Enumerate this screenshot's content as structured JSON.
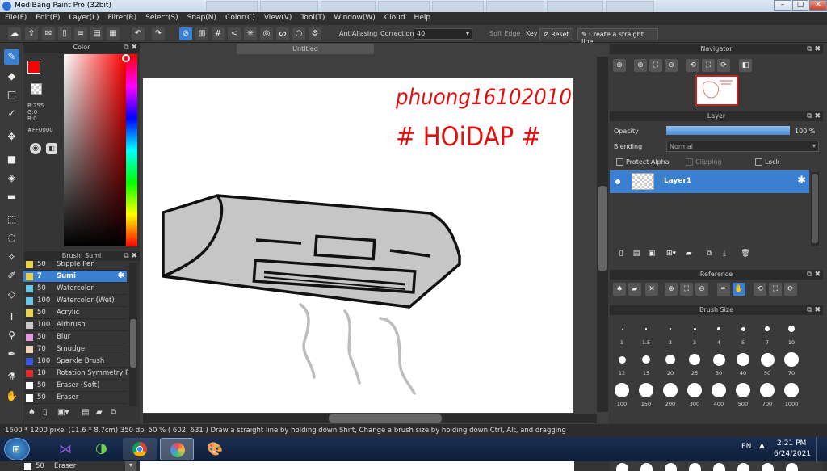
{
  "window": {
    "title": "MediBang Paint Pro (32bit)",
    "controls": [
      "–",
      "□",
      "✕"
    ]
  },
  "menu": [
    "File(F)",
    "Edit(E)",
    "Layer(L)",
    "Filter(R)",
    "Select(S)",
    "Snap(N)",
    "Color(C)",
    "View(V)",
    "Tool(T)",
    "Window(W)",
    "Cloud",
    "Help"
  ],
  "toolbar": {
    "antialiasing_label": "AntiAliasing",
    "correction_label": "Correction",
    "correction_value": "40",
    "soft_edge_label": "Soft Edge",
    "key_label": "Key",
    "reset_label": "Reset",
    "straight_line_label": "Create a straight line"
  },
  "color_panel": {
    "title": "Color",
    "rgb": [
      "R:255",
      "G:0",
      "B:0"
    ],
    "hex": "#FF0000",
    "primary_color": "#ff0000"
  },
  "brush_panel": {
    "title": "Brush: Sumi",
    "items": [
      {
        "size": "50",
        "name": "Stipple Pen",
        "color": "#e8d24a"
      },
      {
        "size": "7",
        "name": "Sumi",
        "color": "#e8d24a",
        "selected": true
      },
      {
        "size": "50",
        "name": "Watercolor",
        "color": "#67c7e8"
      },
      {
        "size": "100",
        "name": "Watercolor (Wet)",
        "color": "#67c7e8"
      },
      {
        "size": "50",
        "name": "Acrylic",
        "color": "#e8d24a"
      },
      {
        "size": "100",
        "name": "Airbrush",
        "color": "#c8c8c8"
      },
      {
        "size": "50",
        "name": "Blur",
        "color": "#e597e0"
      },
      {
        "size": "70",
        "name": "Smudge",
        "color": "#f2d2b8"
      },
      {
        "size": "100",
        "name": "Sparkle Brush",
        "color": "#3a55e0"
      },
      {
        "size": "10",
        "name": "Rotation Symmetry P",
        "color": "#e02a2a"
      },
      {
        "size": "50",
        "name": "Eraser (Soft)",
        "color": "#ffffff"
      },
      {
        "size": "50",
        "name": "Eraser",
        "color": "#ffffff"
      }
    ]
  },
  "document": {
    "tab_title": "Untitled",
    "handwriting_line1": "phuong16102010",
    "handwriting_line2": "# HOiDAP #"
  },
  "navigator": {
    "title": "Navigator"
  },
  "layer_panel": {
    "title": "Layer",
    "opacity_label": "Opacity",
    "opacity_value": "100 %",
    "opacity_level": 1.0,
    "blending_label": "Blending",
    "blending_value": "Normal",
    "protect_alpha_label": "Protect Alpha",
    "clipping_label": "Clipping",
    "lock_label": "Lock",
    "layer_name": "Layer1"
  },
  "reference_panel": {
    "title": "Reference"
  },
  "brush_size_panel": {
    "title": "Brush Size",
    "sizes": [
      "1",
      "1.5",
      "2",
      "3",
      "4",
      "5",
      "7",
      "10",
      "12",
      "15",
      "20",
      "25",
      "30",
      "40",
      "50",
      "70",
      "100",
      "150",
      "200",
      "300",
      "400",
      "500",
      "700",
      "1000"
    ]
  },
  "status_bar": {
    "text": "1600 * 1200 pixel  (11.6 * 8.7cm)  350 dpi  50 %  ( 602, 631 )  Draw a straight line by holding down Shift, Change a brush size by holding down Ctrl, Alt, and dragging"
  },
  "taskbar": {
    "lang": "EN",
    "time": "2:21 PM",
    "date": "6/24/2021"
  },
  "bottom_strip": {
    "size": "50",
    "name": "Eraser"
  },
  "colors": {
    "accent": "#3b7fd0",
    "panel": "#353535",
    "ink_red": "#e01010"
  }
}
